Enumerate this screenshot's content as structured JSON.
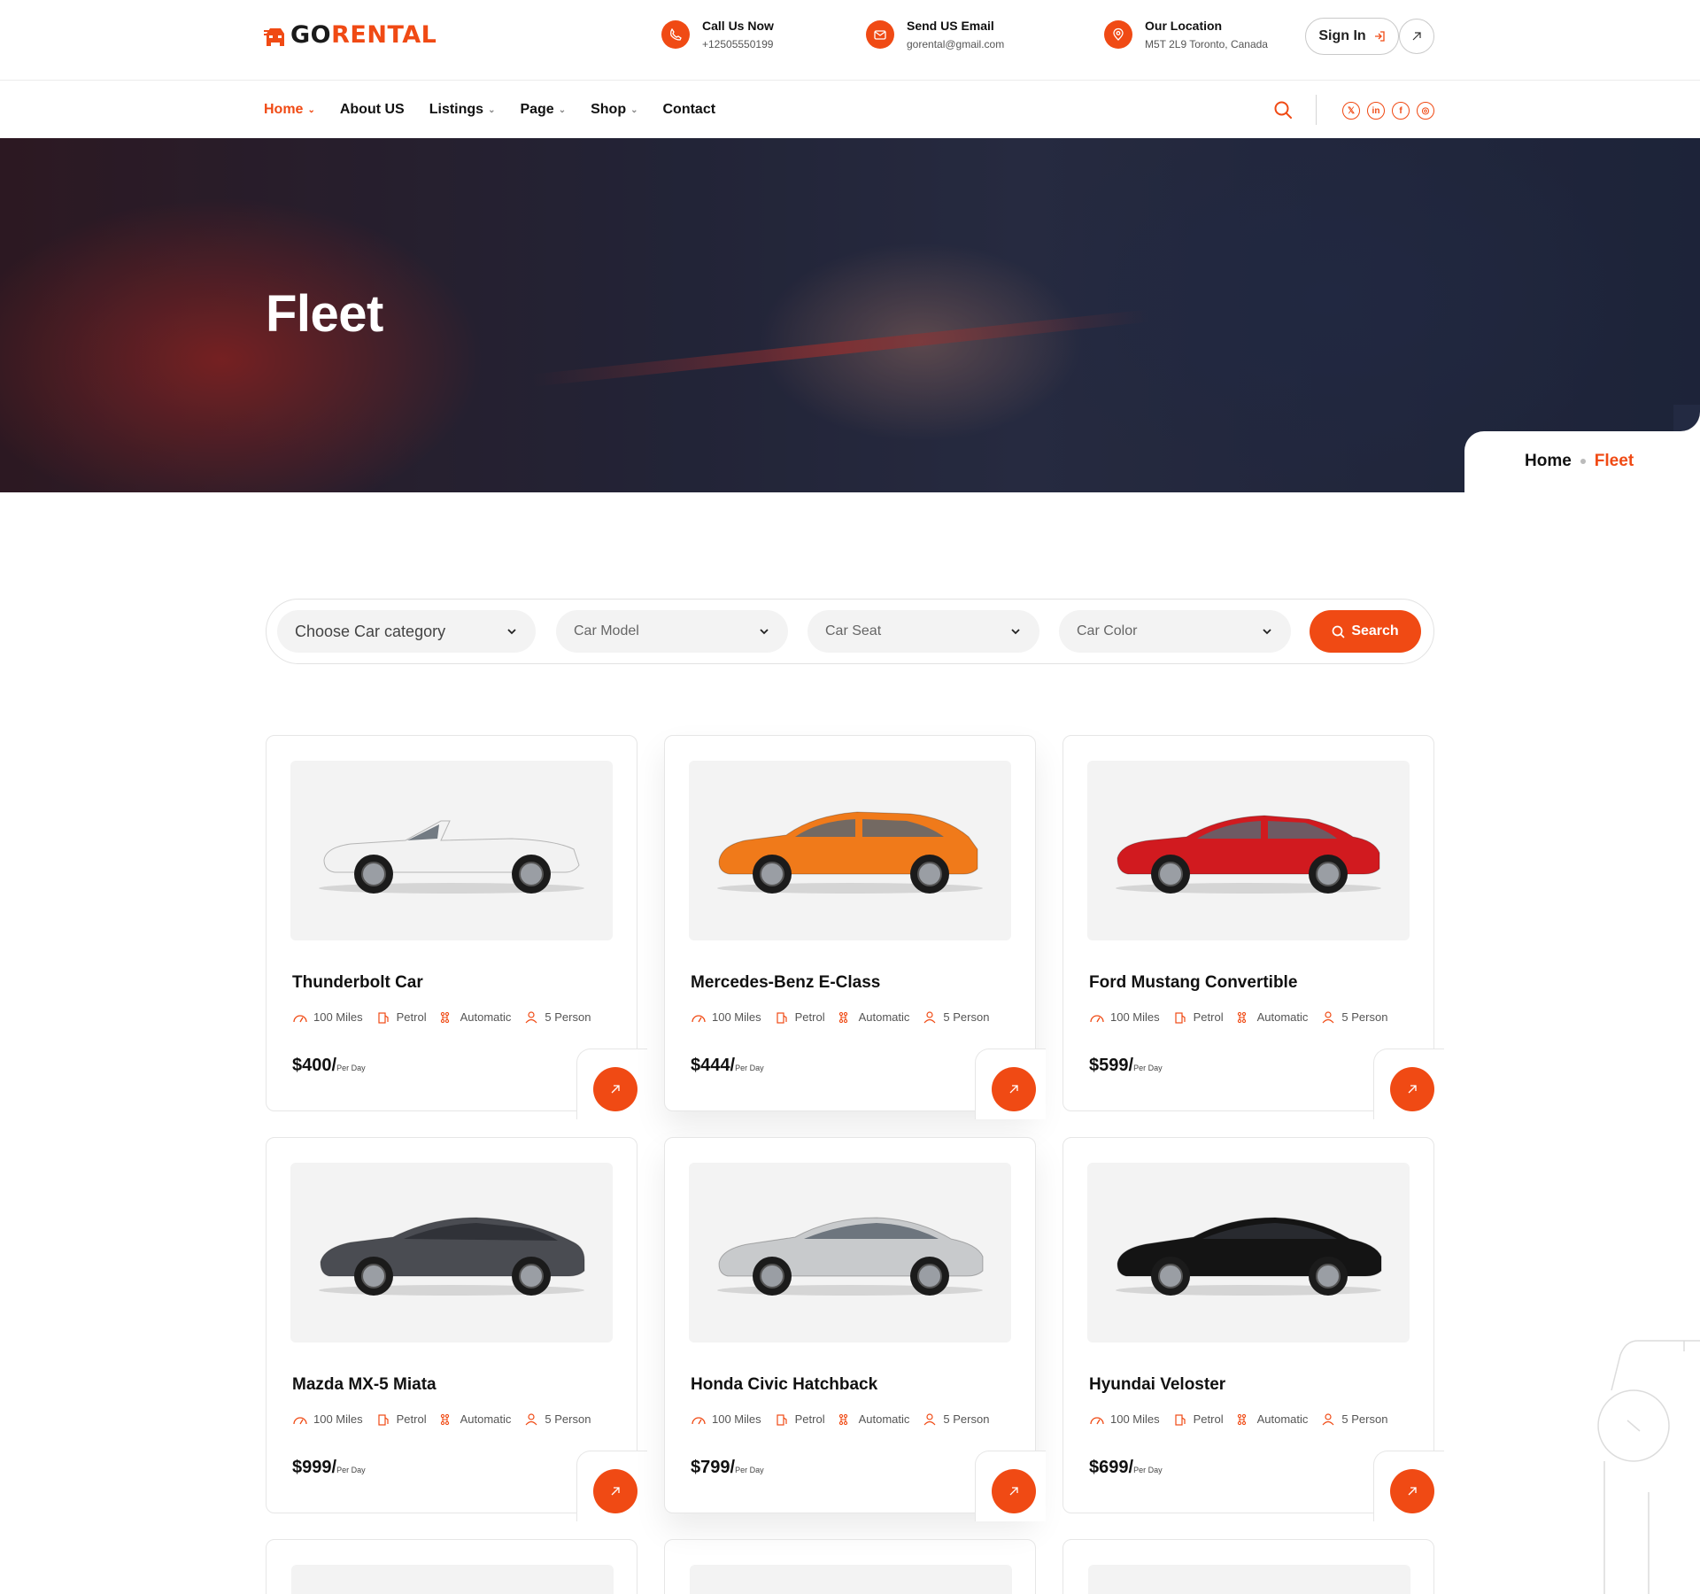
{
  "brand": {
    "prefix": "GO",
    "suffix": "RENTAL"
  },
  "contacts": [
    {
      "title": "Call Us Now",
      "value": "+12505550199",
      "icon": "phone-icon"
    },
    {
      "title": "Send US Email",
      "value": "gorental@gmail.com",
      "icon": "mail-icon"
    },
    {
      "title": "Our Location",
      "value": "M5T 2L9 Toronto, Canada",
      "icon": "location-pin-icon"
    }
  ],
  "signin_label": "Sign In",
  "nav": [
    {
      "label": "Home",
      "dropdown": true,
      "active": true
    },
    {
      "label": "About US",
      "dropdown": false,
      "active": false
    },
    {
      "label": "Listings",
      "dropdown": true,
      "active": false
    },
    {
      "label": "Page",
      "dropdown": true,
      "active": false
    },
    {
      "label": "Shop",
      "dropdown": true,
      "active": false
    },
    {
      "label": "Contact",
      "dropdown": false,
      "active": false
    }
  ],
  "socials": [
    {
      "name": "x-twitter-icon",
      "glyph": "𝕏"
    },
    {
      "name": "linkedin-icon",
      "glyph": "in"
    },
    {
      "name": "facebook-icon",
      "glyph": "f"
    },
    {
      "name": "instagram-icon",
      "glyph": "◎"
    }
  ],
  "hero": {
    "title": "Fleet"
  },
  "breadcrumb": {
    "home": "Home",
    "current": "Fleet"
  },
  "filters": {
    "category": "Choose Car category",
    "model": "Car Model",
    "seat": "Car Seat",
    "color": "Car Color",
    "search_label": "Search"
  },
  "per_day_label": "Per Day",
  "cars": [
    {
      "name": "Thunderbolt Car",
      "miles": "100 Miles",
      "fuel": "Petrol",
      "transmission": "Automatic",
      "seats": "5 Person",
      "price": "$400/",
      "color": "#f2f2f2",
      "style": "convertible"
    },
    {
      "name": "Mercedes-Benz E-Class",
      "miles": "100 Miles",
      "fuel": "Petrol",
      "transmission": "Automatic",
      "seats": "5 Person",
      "price": "$444/",
      "color": "#f07a1a",
      "style": "hatch"
    },
    {
      "name": "Ford Mustang Convertible",
      "miles": "100 Miles",
      "fuel": "Petrol",
      "transmission": "Automatic",
      "seats": "5 Person",
      "price": "$599/",
      "color": "#d11a1f",
      "style": "sedan"
    },
    {
      "name": "Mazda MX-5 Miata",
      "miles": "100 Miles",
      "fuel": "Petrol",
      "transmission": "Automatic",
      "seats": "5 Person",
      "price": "$999/",
      "color": "#4a4c52",
      "style": "fastback"
    },
    {
      "name": "Honda Civic Hatchback",
      "miles": "100 Miles",
      "fuel": "Petrol",
      "transmission": "Automatic",
      "seats": "5 Person",
      "price": "$799/",
      "color": "#c8cacc",
      "style": "coupe"
    },
    {
      "name": "Hyundai Veloster",
      "miles": "100 Miles",
      "fuel": "Petrol",
      "transmission": "Automatic",
      "seats": "5 Person",
      "price": "$699/",
      "color": "#141414",
      "style": "coupe"
    }
  ],
  "colors": {
    "accent": "#f04a14"
  }
}
